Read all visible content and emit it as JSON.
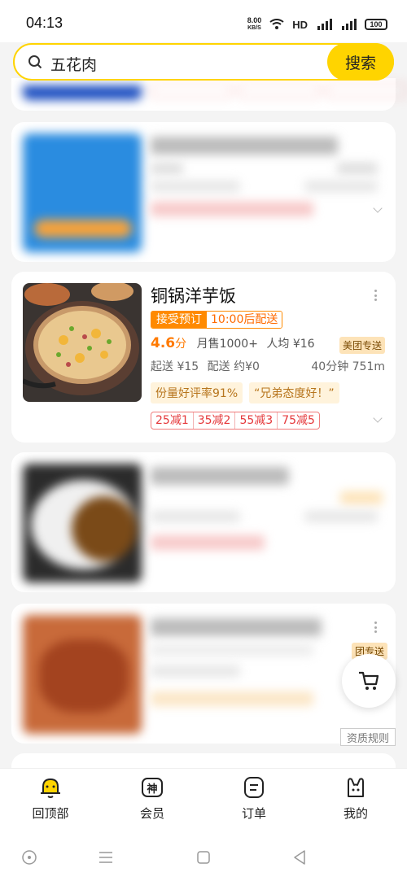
{
  "status": {
    "time": "04:13",
    "net_speed_value": "8.00",
    "net_speed_unit": "KB/S",
    "hd": "HD",
    "battery": "100"
  },
  "search": {
    "query": "五花肉",
    "button_label": "搜索"
  },
  "restaurant": {
    "name": "铜锅洋芋饭",
    "preorder_tag": "接受预订",
    "delivery_time_tag": "10:00后配送",
    "rating": "4.6",
    "rating_unit": "分",
    "monthly_sales": "月售1000+",
    "avg_price": "人均 ¥16",
    "delivery_badge": "美团专送",
    "min_order": "起送 ¥15",
    "delivery_fee": "配送 约¥0",
    "eta_distance": "40分钟 751m",
    "highlights": [
      "份量好评率91%",
      "“兄弟态度好！”"
    ],
    "discounts": [
      "25减1",
      "35减2",
      "55减3",
      "75减5"
    ]
  },
  "partial_card": {
    "delivery_badge": "团专送"
  },
  "qualification_label": "资质规则",
  "tabbar": {
    "items": [
      {
        "label": "回顶部",
        "icon": "bell-icon"
      },
      {
        "label": "会员",
        "icon": "shen-icon"
      },
      {
        "label": "订单",
        "icon": "order-icon"
      },
      {
        "label": "我的",
        "icon": "rabbit-icon"
      }
    ]
  },
  "colors": {
    "brand_yellow": "#ffd400",
    "accent_orange": "#ff8a00",
    "discount_red": "#e5383b"
  }
}
